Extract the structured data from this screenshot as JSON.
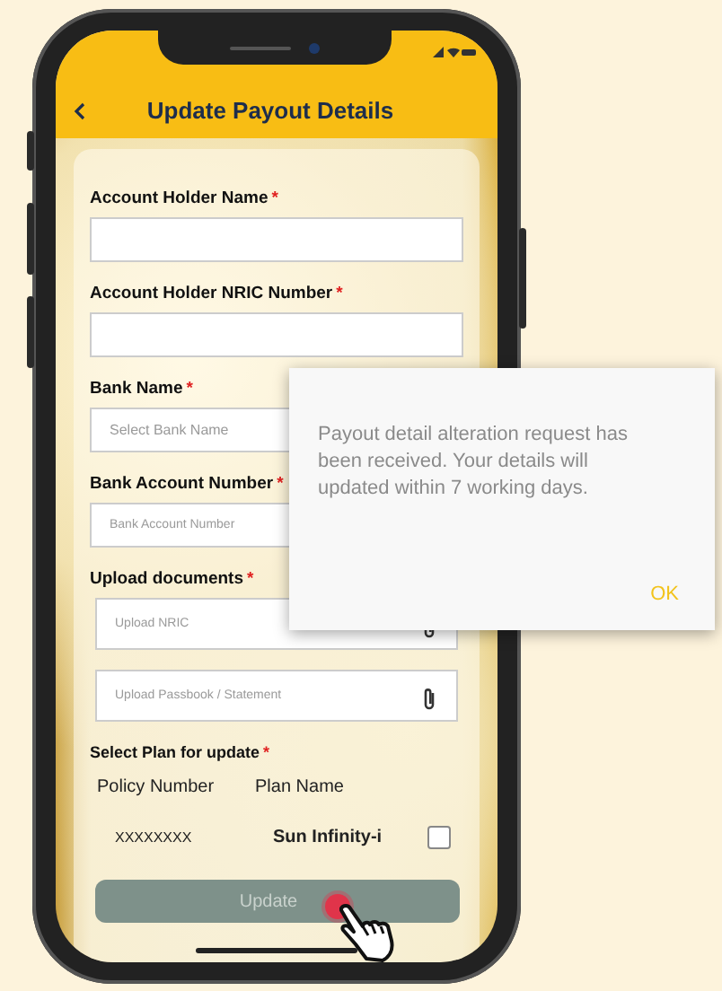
{
  "header": {
    "title": "Update Payout Details"
  },
  "form": {
    "fields": [
      {
        "kind": "text",
        "label": "Account Holder Name",
        "mark": "*"
      },
      {
        "kind": "text",
        "label": "Account Holder NRIC Number",
        "mark": "*"
      },
      {
        "kind": "select",
        "label": "Bank Name",
        "mark": "*",
        "placeholder": "Select Bank Name"
      },
      {
        "kind": "text",
        "label": "Bank Account Number",
        "mark": "*",
        "placeholder": "Bank Account Number"
      },
      {
        "kind": "upload",
        "label": "Upload documents",
        "mark": "*",
        "inputs": [
          {
            "placeholder": "Upload NRIC"
          },
          {
            "placeholder": "Upload Passbook / Statement"
          }
        ]
      }
    ],
    "plans": {
      "label": "Select Plan for update",
      "mark": "*",
      "columns": [
        "Policy Number",
        "Plan Name"
      ],
      "rows": [
        {
          "policy": "XXXXXXXX",
          "plan": "Sun Infinity-i",
          "checked": false
        }
      ]
    },
    "button": {
      "label": "Update",
      "disabled": true
    }
  },
  "dialog": {
    "message": "Payout detail alteration request has been received. Your details will updated within 7 working days.",
    "button": "OK"
  }
}
